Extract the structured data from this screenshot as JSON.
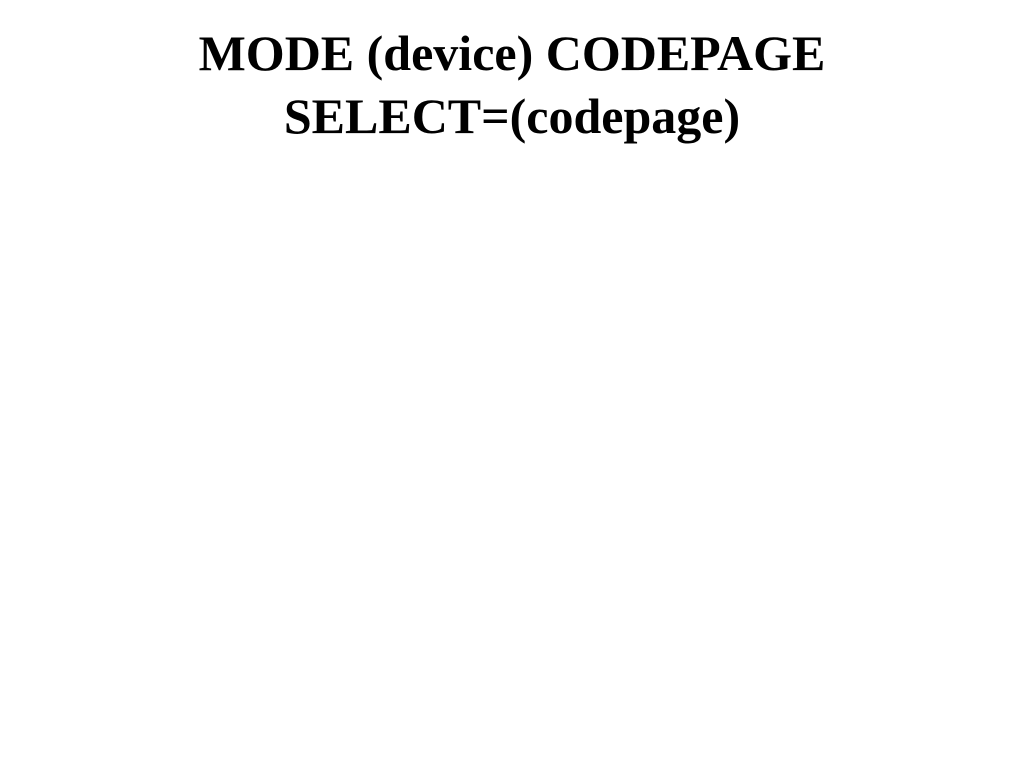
{
  "slide": {
    "title_line1": "MODE (device) CODEPAGE",
    "title_line2": "SELECT=(codepage)"
  }
}
